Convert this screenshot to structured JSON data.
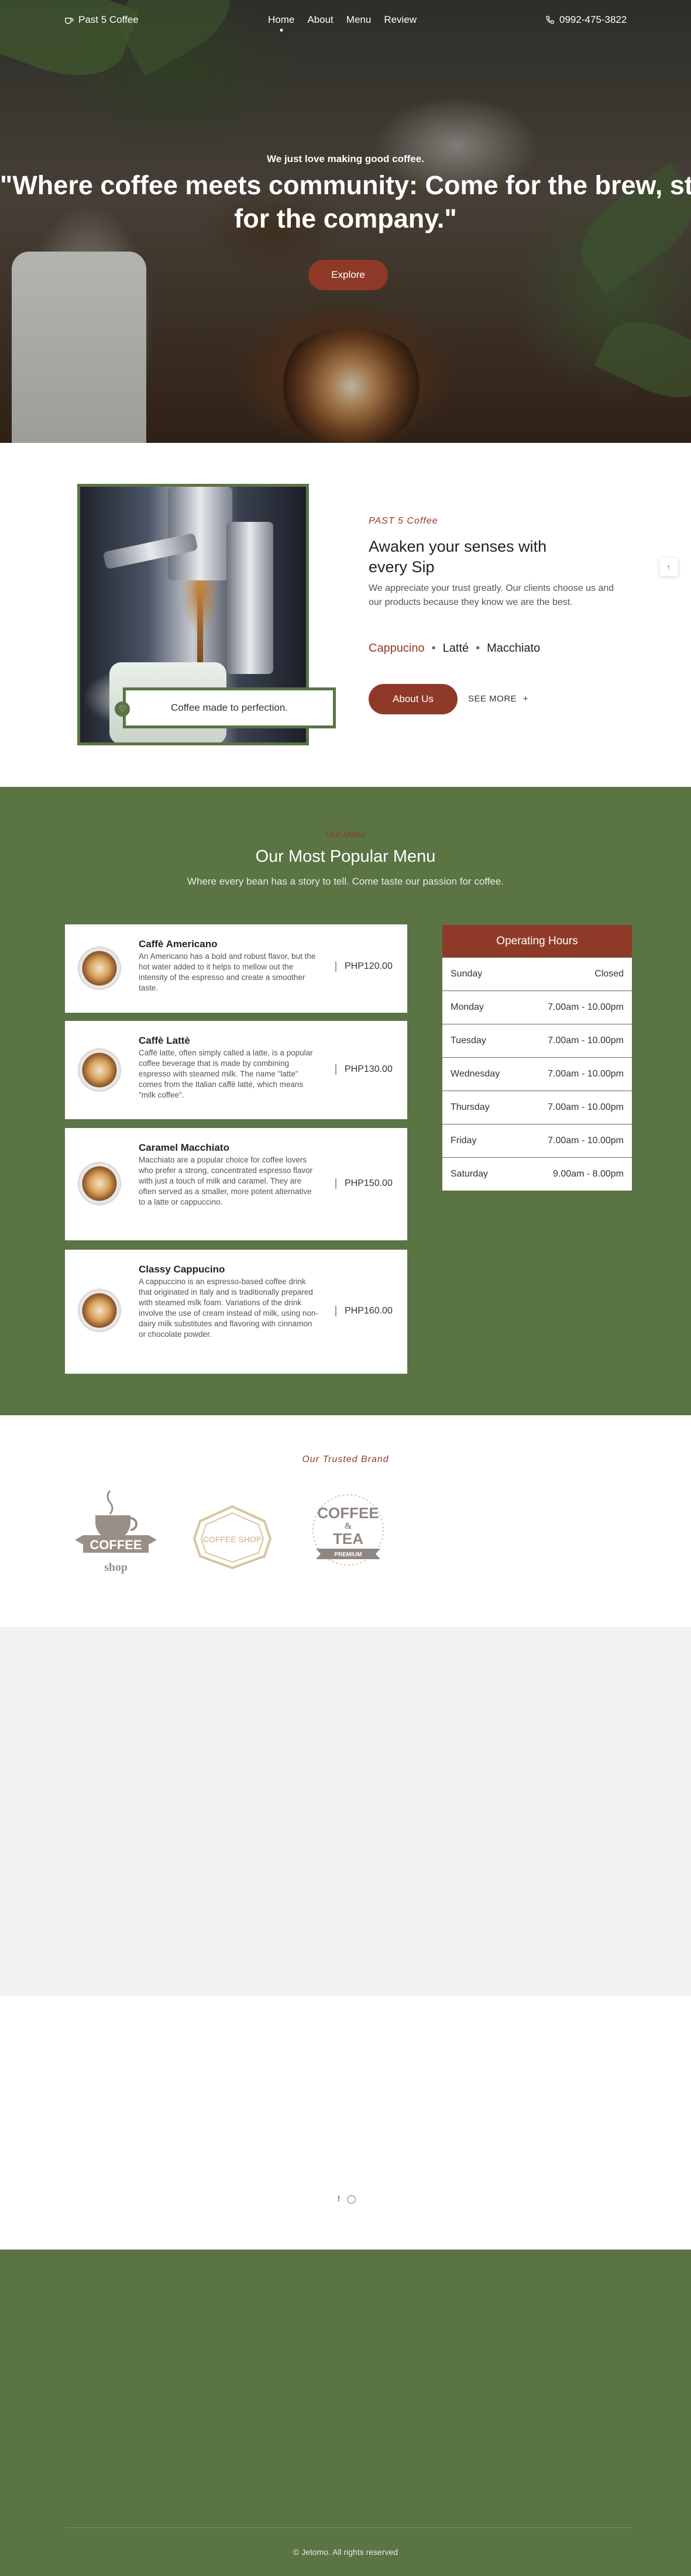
{
  "header": {
    "brand": "Past 5 Coffee",
    "nav": [
      "Home",
      "About",
      "Menu",
      "Review"
    ],
    "phone": "0992-475-3822"
  },
  "hero": {
    "tagline": "We just love making good coffee.",
    "quote_line1": "\"Where coffee meets community: Come for the brew, stay",
    "quote_line2": "for the company.\"",
    "button": "Explore"
  },
  "about": {
    "kicker": "PAST 5 Coffee",
    "title": "Awaken your senses with every Sip",
    "description": "We appreciate your trust greatly. Our clients choose us and our products because they know we are the best.",
    "types": [
      "Cappucino",
      "Latté",
      "Macchiato"
    ],
    "badge_text": "Coffee made to perfection.",
    "about_button": "About Us",
    "see_more": "SEE MORE"
  },
  "menu": {
    "kicker": "Our Menu",
    "title": "Our Most Popular Menu",
    "subtitle": "Where every bean has a story to tell. Come taste our passion for coffee.",
    "items": [
      {
        "name": "Caffè Americano",
        "description": "An Americano has a bold and robust flavor, but the hot water added to it helps to mellow out the intensity of the espresso and create a smoother taste.",
        "price": "PHP120.00"
      },
      {
        "name": "Caffè Lattè",
        "description": "Caffè latte, often simply called a latte, is a popular coffee beverage that is made by combining espresso with steamed milk. The name \"latte\" comes from the Italian caffè lattè, which means \"milk coffee\".",
        "price": "PHP130.00"
      },
      {
        "name": "Caramel Macchiato",
        "description": "Macchiato are a popular choice for coffee lovers who prefer a strong, concentrated espresso flavor with just a touch of milk and caramel. They are often served as a smaller, more potent alternative to a latte or cappuccino.",
        "price": "PHP150.00"
      },
      {
        "name": "Classy Cappucino",
        "description": "A cappuccino is an espresso-based coffee drink that originated in Italy and is traditionally prepared with steamed milk foam. Variations of the drink involve the use of cream instead of milk, using non-dairy milk substitutes and flavoring with cinnamon or chocolate powder.",
        "price": "PHP160.00"
      }
    ]
  },
  "hours": {
    "title": "Operating Hours",
    "rows": [
      {
        "day": "Sunday",
        "time": "Closed"
      },
      {
        "day": "Monday",
        "time": "7.00am - 10.00pm"
      },
      {
        "day": "Tuesday",
        "time": "7.00am - 10.00pm"
      },
      {
        "day": "Wednesday",
        "time": "7.00am - 10.00pm"
      },
      {
        "day": "Thursday",
        "time": "7.00am - 10.00pm"
      },
      {
        "day": "Friday",
        "time": "7.00am - 10.00pm"
      },
      {
        "day": "Saturday",
        "time": "9.00am - 8.00pm"
      }
    ]
  },
  "brands": {
    "kicker": "Our Trusted Brand",
    "logo1": [
      "COFFEE",
      "shop"
    ],
    "logo2": "COFFEE SHOP",
    "logo3": [
      "COFFEE",
      "&",
      "TEA",
      "PREMIUM"
    ]
  },
  "footer": {
    "copyright": "© Jetomo. All rights reserved"
  },
  "colors": {
    "brand_green": "#5a7444",
    "accent_red": "#8f3a28",
    "logo_gray": "#9a8f88"
  },
  "icons": [
    "cup-icon",
    "phone-icon",
    "heart-icon",
    "arrow-up-icon",
    "plus-icon",
    "facebook-icon",
    "github-icon"
  ]
}
